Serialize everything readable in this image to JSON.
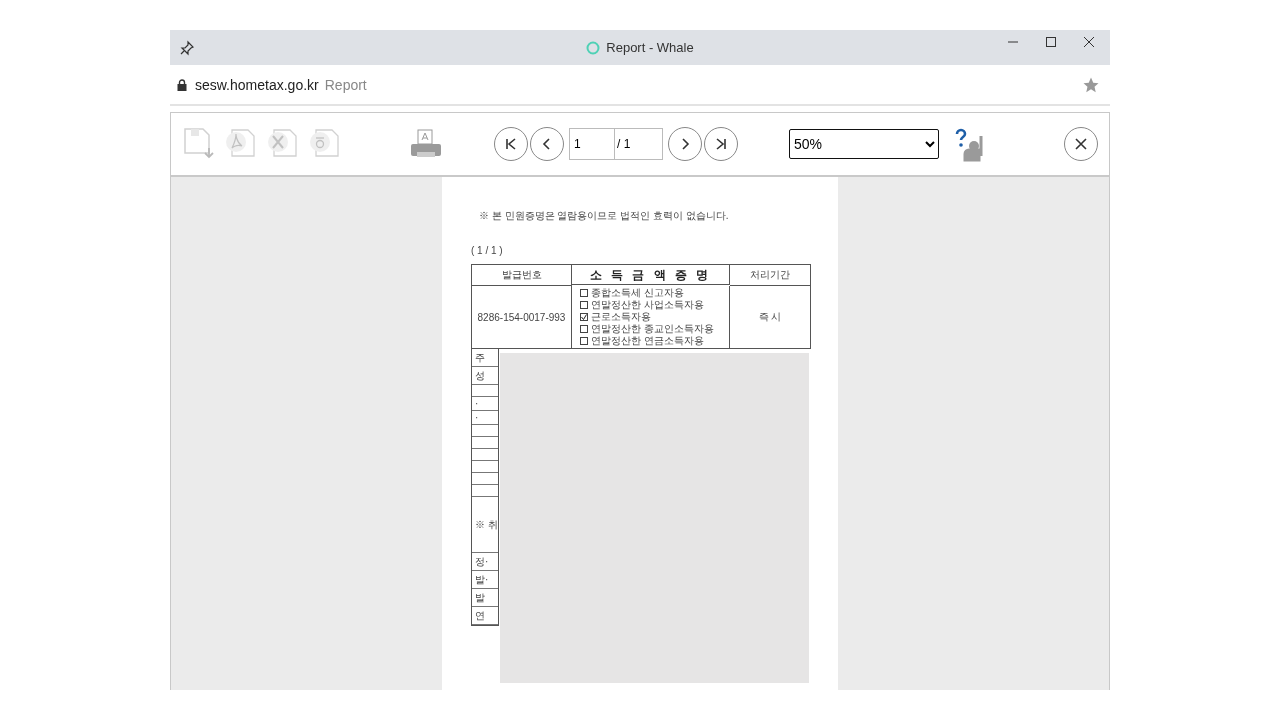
{
  "window": {
    "title": "Report - Whale"
  },
  "address_bar": {
    "host": "sesw.hometax.go.kr",
    "page_title": "Report"
  },
  "toolbar": {
    "export_buttons": [
      {
        "kind": "save",
        "disabled": true
      },
      {
        "kind": "pdf",
        "disabled": true
      },
      {
        "kind": "excel",
        "disabled": true
      },
      {
        "kind": "hwp",
        "disabled": true
      }
    ],
    "page_field": {
      "value": "1"
    },
    "page_total": "/ 1",
    "zoom": {
      "value": "50%"
    }
  },
  "document": {
    "notice": "※ 본 민원증명은 열람용이므로 법적인 효력이 없습니다.",
    "page_counter": "( 1 / 1 )",
    "header": {
      "number_label": "발급번호",
      "number": "8286-154-0017-993",
      "title": "소 득 금 액 증 명",
      "period_label": "처리기간",
      "period": "즉 시"
    },
    "options": [
      {
        "label": "종합소득세 신고자용",
        "checked": false
      },
      {
        "label": "연말정산한 사업소득자용",
        "checked": false
      },
      {
        "label": "근로소득자용",
        "checked": true
      },
      {
        "label": "연말정산한 종교인소득자용",
        "checked": false
      },
      {
        "label": "연말정산한 연금소득자용",
        "checked": false
      }
    ],
    "row_stubs": [
      {
        "kind": "label",
        "label": "주"
      },
      {
        "kind": "label",
        "label": "성"
      },
      {
        "kind": "blank"
      },
      {
        "kind": "short",
        "label": "·"
      },
      {
        "kind": "short",
        "label": "·"
      },
      {
        "kind": "blank"
      },
      {
        "kind": "blank"
      },
      {
        "kind": "blank"
      },
      {
        "kind": "blank"
      },
      {
        "kind": "blank"
      },
      {
        "kind": "blank"
      },
      {
        "kind": "tall",
        "label": "※ 취"
      },
      {
        "kind": "label",
        "label": "정·"
      },
      {
        "kind": "label",
        "label": "발·"
      },
      {
        "kind": "label",
        "label": "발"
      },
      {
        "kind": "label",
        "label": "연"
      }
    ]
  }
}
